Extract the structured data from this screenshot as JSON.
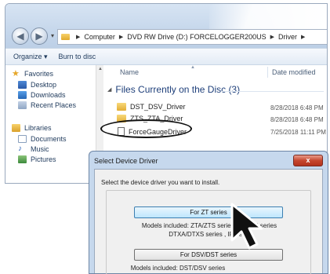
{
  "explorer": {
    "breadcrumb": [
      "Computer",
      "DVD RW Drive (D:) FORCELOGGER200US",
      "Driver"
    ],
    "toolbar": {
      "organize": "Organize ▾",
      "burn": "Burn to disc"
    },
    "sidebar": {
      "favorites": "Favorites",
      "desktop": "Desktop",
      "downloads": "Downloads",
      "recent": "Recent Places",
      "libraries": "Libraries",
      "documents": "Documents",
      "music": "Music",
      "pictures": "Pictures"
    },
    "columns": {
      "name": "Name",
      "date": "Date modified"
    },
    "group_label": "Files Currently on the Disc (3)",
    "files": [
      {
        "name": "DST_DSV_Driver",
        "date": "8/28/2018 6:48 PM",
        "type": "folder"
      },
      {
        "name": "ZTS_ZTA_Driver",
        "date": "8/28/2018 6:48 PM",
        "type": "folder"
      },
      {
        "name": "ForceGaugeDriver",
        "date": "7/25/2018 11:11 PM",
        "type": "file"
      }
    ]
  },
  "dialog": {
    "title": "Select Device Driver",
    "close_label": "x",
    "prompt": "Select the device driver you want to install.",
    "zt_button": "For ZT series",
    "zt_models_1": "Models included: ZTA/ZTS series , H        TGS series",
    "zt_models_2": "DTXA/DTXS series , IP          , eZT",
    "dsv_button": "For DSV/DST series",
    "dsv_models": "Models included: DST/DSV series"
  },
  "icons": {
    "back": "back-arrow-icon",
    "forward": "forward-arrow-icon",
    "folder": "folder-icon",
    "file": "file-icon",
    "star": "star-icon",
    "music": "music-note-icon",
    "cursor": "mouse-pointer-icon"
  },
  "colors": {
    "accent": "#1e395b",
    "close_button": "#c6472f",
    "dialog_frame": "#c6d8ed"
  }
}
